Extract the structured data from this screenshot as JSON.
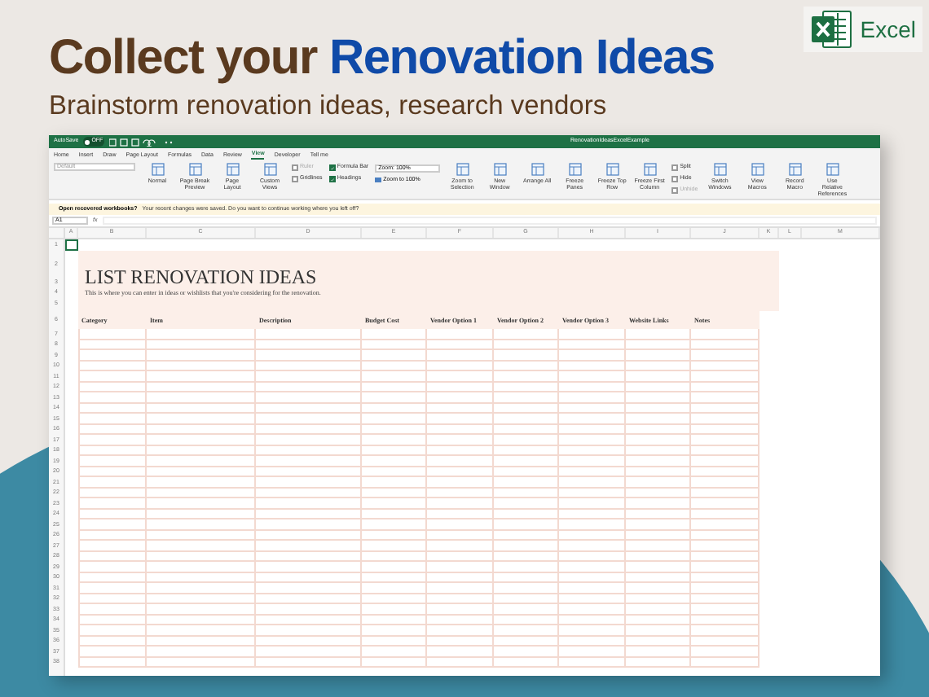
{
  "hero": {
    "title": [
      {
        "text": "Collect your",
        "kind": "plain"
      },
      {
        "text": "Renovation Ideas",
        "kind": "accent"
      }
    ],
    "subtitle": "Brainstorm renovation ideas, research vendors"
  },
  "badge": {
    "label": "Excel"
  },
  "window": {
    "autosave_label": "AutoSave",
    "autosave_state": "OFF",
    "autosave_on": false,
    "file_name": "RenovationIdeasExcelExample"
  },
  "ribbon_tabs": [
    {
      "label": "Home",
      "selected": false
    },
    {
      "label": "Insert",
      "selected": false
    },
    {
      "label": "Draw",
      "selected": false
    },
    {
      "label": "Page Layout",
      "selected": false
    },
    {
      "label": "Formulas",
      "selected": false
    },
    {
      "label": "Data",
      "selected": false
    },
    {
      "label": "Review",
      "selected": false
    },
    {
      "label": "View",
      "selected": true
    },
    {
      "label": "Developer",
      "selected": false
    },
    {
      "label": "Tell me",
      "selected": false
    }
  ],
  "ribbon": [
    {
      "kind": "dropdown",
      "label": "Default"
    },
    {
      "kind": "button",
      "label": "Normal"
    },
    {
      "kind": "button",
      "label": "Page Break Preview"
    },
    {
      "kind": "button",
      "label": "Page Layout"
    },
    {
      "kind": "button",
      "label": "Custom Views"
    },
    {
      "kind": "checks",
      "items": [
        {
          "label": "Ruler",
          "checked": false,
          "disabled": true
        },
        {
          "label": "Gridlines",
          "checked": false,
          "disabled": false
        }
      ]
    },
    {
      "kind": "checks",
      "items": [
        {
          "label": "Formula Bar",
          "checked": true,
          "disabled": false
        },
        {
          "label": "Headings",
          "checked": true,
          "disabled": false
        }
      ]
    },
    {
      "kind": "zoom",
      "label": "Zoom: 100%",
      "action": "Zoom to 100%"
    },
    {
      "kind": "button",
      "label": "Zoom to Selection"
    },
    {
      "kind": "button",
      "label": "New Window"
    },
    {
      "kind": "button",
      "label": "Arrange All"
    },
    {
      "kind": "button",
      "label": "Freeze Panes"
    },
    {
      "kind": "button",
      "label": "Freeze Top Row"
    },
    {
      "kind": "button",
      "label": "Freeze First Column"
    },
    {
      "kind": "checks",
      "items": [
        {
          "label": "Split",
          "checked": false,
          "disabled": false
        },
        {
          "label": "Hide",
          "checked": false,
          "disabled": false
        },
        {
          "label": "Unhide",
          "checked": false,
          "disabled": true
        }
      ]
    },
    {
      "kind": "button",
      "label": "Switch Windows"
    },
    {
      "kind": "button",
      "label": "View Macros"
    },
    {
      "kind": "button",
      "label": "Record Macro"
    },
    {
      "kind": "button",
      "label": "Use Relative References"
    }
  ],
  "message_bar": {
    "title": "Open recovered workbooks?",
    "text": "Your recent changes were saved. Do you want to continue working where you left off?"
  },
  "formula_bar": {
    "name_box": "A1",
    "fx": "fx"
  },
  "sheet": {
    "columns": [
      "A",
      "B",
      "C",
      "D",
      "E",
      "F",
      "G",
      "H",
      "I",
      "J",
      "K",
      "L",
      "M"
    ],
    "rows": [
      "1",
      "2",
      "3",
      "4",
      "5",
      "6",
      "7",
      "8",
      "9",
      "10",
      "11",
      "12",
      "13",
      "14",
      "15",
      "16",
      "17",
      "18",
      "19",
      "20",
      "21",
      "22",
      "23",
      "24",
      "25",
      "26",
      "27",
      "28",
      "29",
      "30",
      "31",
      "32",
      "33",
      "34",
      "35",
      "36",
      "37",
      "38"
    ],
    "title": "LIST RENOVATION IDEAS",
    "subtitle": "This is where you can enter in ideas or wishlists that you're considering for the renovation.",
    "headers": [
      "Category",
      "Item",
      "Description",
      "Budget Cost",
      "Vendor Option 1",
      "Vendor Option 2",
      "Vendor Option 3",
      "Website Links",
      "Notes"
    ]
  }
}
